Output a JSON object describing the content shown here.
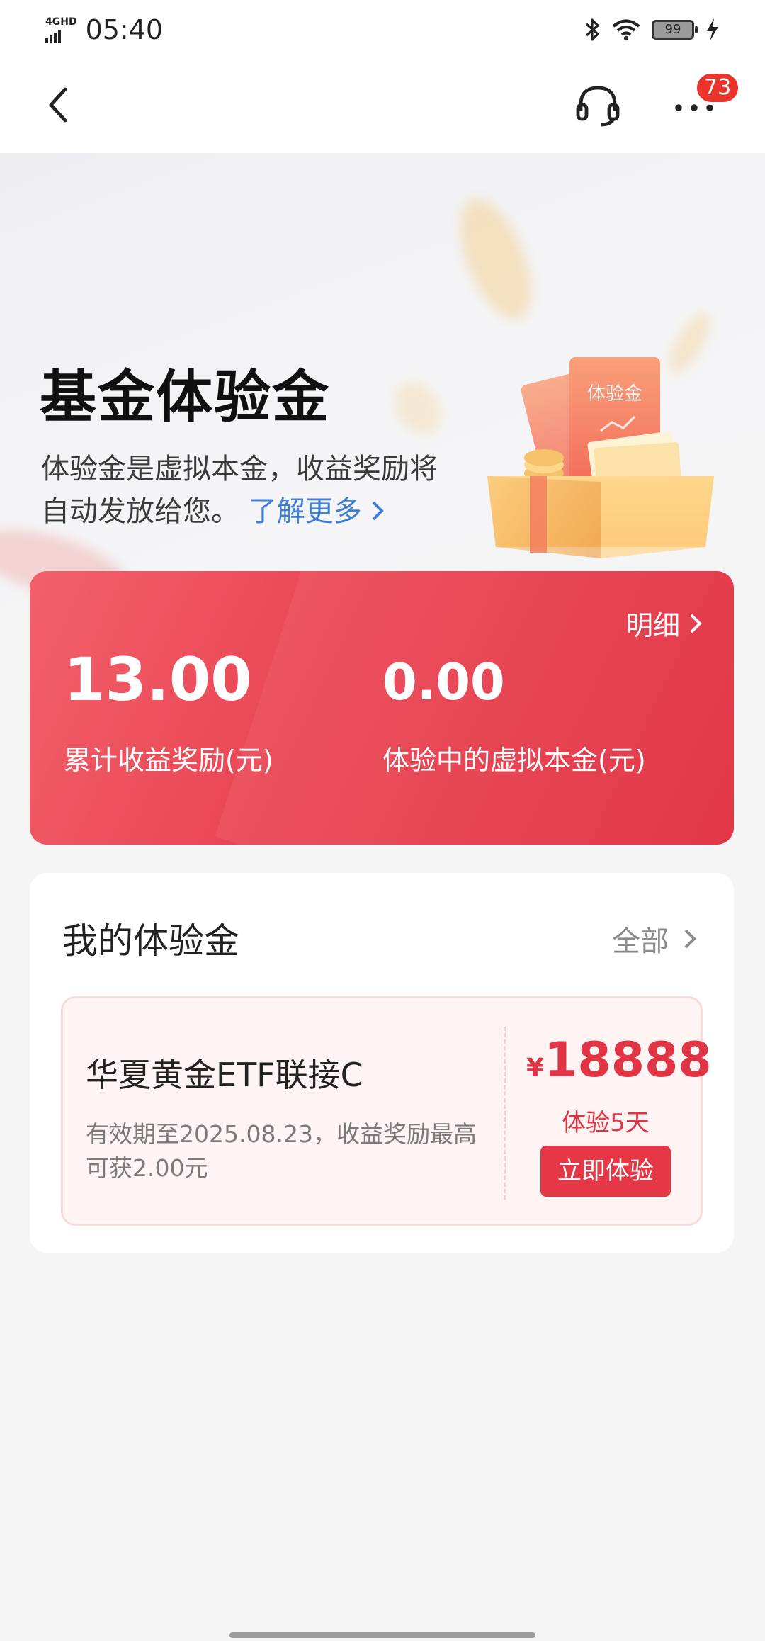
{
  "status_bar": {
    "network": "4GHD",
    "time": "05:40",
    "battery": "99"
  },
  "nav": {
    "badge_count": "73"
  },
  "hero": {
    "title": "基金体验金",
    "description": "体验金是虚拟本金，收益奖励将自动发放给您。",
    "learn_more": "了解更多",
    "illustration_text": "体验金"
  },
  "summary": {
    "detail_label": "明细",
    "total_reward_value": "13.00",
    "total_reward_label": "累计收益奖励(元)",
    "virtual_principal_value": "0.00",
    "virtual_principal_label": "体验中的虚拟本金(元)"
  },
  "my_funds": {
    "title": "我的体验金",
    "all_label": "全部",
    "items": [
      {
        "fund_name": "华夏黄金ETF联接C",
        "description": "有效期至2025.08.23，收益奖励最高可获2.00元",
        "currency": "¥",
        "amount": "18888",
        "duration": "体验5天",
        "action": "立即体验"
      }
    ]
  },
  "colors": {
    "accent_red": "#e53745",
    "link_blue": "#3d7fd6",
    "badge_red": "#e9352c"
  },
  "icons": [
    "signal-icon",
    "bluetooth-icon",
    "wifi-icon",
    "battery-icon",
    "charging-icon",
    "back-icon",
    "headset-icon",
    "more-icon",
    "chevron-right-icon"
  ]
}
